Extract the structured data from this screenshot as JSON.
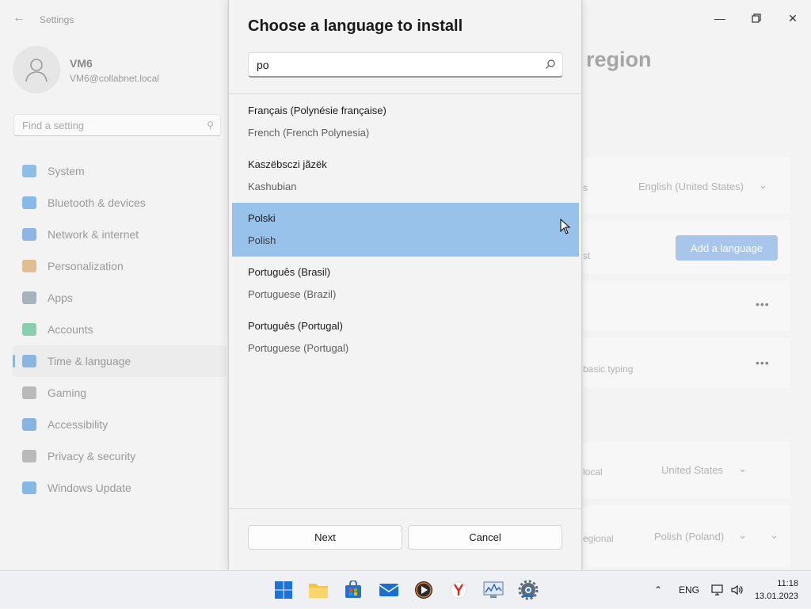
{
  "settings": {
    "title": "Settings",
    "user": {
      "name": "VM6",
      "email": "VM6@collabnet.local"
    },
    "search_placeholder": "Find a setting",
    "nav": [
      {
        "label": "System",
        "color": "#3b8fd8"
      },
      {
        "label": "Bluetooth & devices",
        "color": "#2f8be0"
      },
      {
        "label": "Network & internet",
        "color": "#3a82d9"
      },
      {
        "label": "Personalization",
        "color": "#d2923e"
      },
      {
        "label": "Apps",
        "color": "#6b7d92"
      },
      {
        "label": "Accounts",
        "color": "#2fae78"
      },
      {
        "label": "Time & language",
        "color": "#3a8ad5"
      },
      {
        "label": "Gaming",
        "color": "#8a8a8a"
      },
      {
        "label": "Accessibility",
        "color": "#2d7fd1"
      },
      {
        "label": "Privacy & security",
        "color": "#8a8a8a"
      },
      {
        "label": "Windows Update",
        "color": "#2a86d8"
      }
    ],
    "active_nav": "Time & language",
    "page_title_fragment": "region",
    "cards": {
      "display_language_value": "English (United States)",
      "add_language_label": "Add a language",
      "basic_typing_fragment": "basic typing",
      "country_value": "United States",
      "regional_format_value": "Polish (Poland)",
      "row_fragments": [
        "s",
        "st",
        "local",
        "egional"
      ]
    }
  },
  "dialog": {
    "title": "Choose a language to install",
    "search_value": "po",
    "languages": [
      {
        "native": "Français (Polynésie française)",
        "english": "French (French Polynesia)",
        "selected": false
      },
      {
        "native": "Kaszëbsczi jãzëk",
        "english": "Kashubian",
        "selected": false
      },
      {
        "native": "Polski",
        "english": "Polish",
        "selected": true
      },
      {
        "native": "Português (Brasil)",
        "english": "Portuguese (Brazil)",
        "selected": false
      },
      {
        "native": "Português (Portugal)",
        "english": "Portuguese (Portugal)",
        "selected": false
      }
    ],
    "next_label": "Next",
    "cancel_label": "Cancel"
  },
  "taskbar": {
    "language": "ENG",
    "time": "11:18",
    "date": "13.01.2023"
  }
}
